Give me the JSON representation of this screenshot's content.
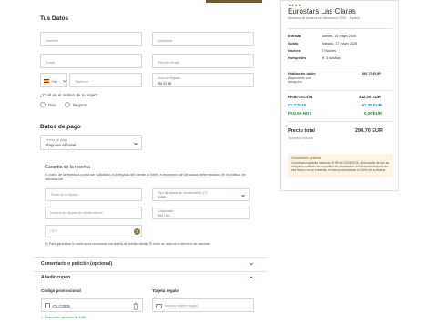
{
  "form": {
    "section_title": "Tus Datos",
    "name_placeholder": "Nombre",
    "surname_placeholder": "Apellidos",
    "email_placeholder": "Email",
    "repeat_email_placeholder": "Repetir email",
    "phone_prefix": "+34",
    "phone_placeholder": "Teléfono",
    "arrival_time_label": "Hora de llegada",
    "arrival_time_value": "No lo sé",
    "trip_reason_question": "¿Cuál es el motivo de tu viaje?",
    "trip_reason_options": [
      "Ocio",
      "Negocio"
    ]
  },
  "payment": {
    "section_title": "Datos de pago",
    "method_label": "Forma de pago",
    "method_value": "Pago en el hotel",
    "guarantee_title": "Garantía de la reserva",
    "guarantee_text": "El cobro de la estancia podrá ser solicitado a la llegada del cliente al hotel, a excepción de los casos determinados en la política de cancelación.",
    "card_holder_placeholder": "Titular de la tarjeta",
    "card_type_label": "Tipo de tarjeta de crédito/débito (*)",
    "card_type_value": "VISA",
    "card_number_placeholder": "Número de tarjeta de crédito/débito",
    "expiry_label": "Caducidad",
    "expiry_value": "MM / AA",
    "cvv_placeholder": "CCV",
    "footnote": "(*) Para garantizar tu reserva es necesaria una tarjeta de crédito válida. El hotel se reserva el derecho de cancelar"
  },
  "sections": {
    "comment_title": "Comentario o petición (opcional)",
    "coupon_title": "Añadir cupón",
    "promo_code_label": "Código promocional",
    "promo_code_value": "CILC2025",
    "gift_card_label": "Tarjeta regalo",
    "gift_card_placeholder": "Insertar tarjeta regalo",
    "promo_applied_text": "Descuento aplicado de 13%"
  },
  "summary": {
    "stars": "★★★★",
    "hotel_name": "Eurostars Las Claras",
    "address": "Marquesa de Almarza s/n Salamanca 37001 , España",
    "rows": [
      {
        "label": "Entrada",
        "value": "Jueves, 15 mayo 2025"
      },
      {
        "label": "Salida",
        "value": "Sábado, 17 mayo 2025"
      },
      {
        "label": "Noches",
        "value": "2 Noches"
      },
      {
        "label": "Huéspedes",
        "value": "2 Adultos"
      }
    ],
    "room_name": "Habitación doble",
    "room_desc": "Alojamiento con desayuno",
    "room_price": "390,70 EUR",
    "room_total_label": "HABITACIÓN",
    "room_total_value": "342,00 EUR",
    "discount_label": "CILC2025",
    "discount_value": "-51,30 EUR",
    "pay_now_label": "PAGAR HOY",
    "pay_now_value": "0,00 EUR",
    "final_label": "Precio total",
    "final_value": "290,70 EUR",
    "taxes_note": "Impuestos incluidos",
    "cancel_title": "Cancelación gratuita",
    "cancel_text": "Cancelación gratuita hasta las 22:59 del 12/05/2025, a excepción de que se indique lo contrario en su política de cancelación. Si la cancela después de esa fecha o no se presenta, el hotel podrá facturar el 100% de la reserva."
  },
  "colors": {
    "accent_gold": "#7a5f1e",
    "discount_blue": "#2e7bbf",
    "pay_green": "#1f8a3a",
    "cancel_bg": "#fdf3e3"
  }
}
